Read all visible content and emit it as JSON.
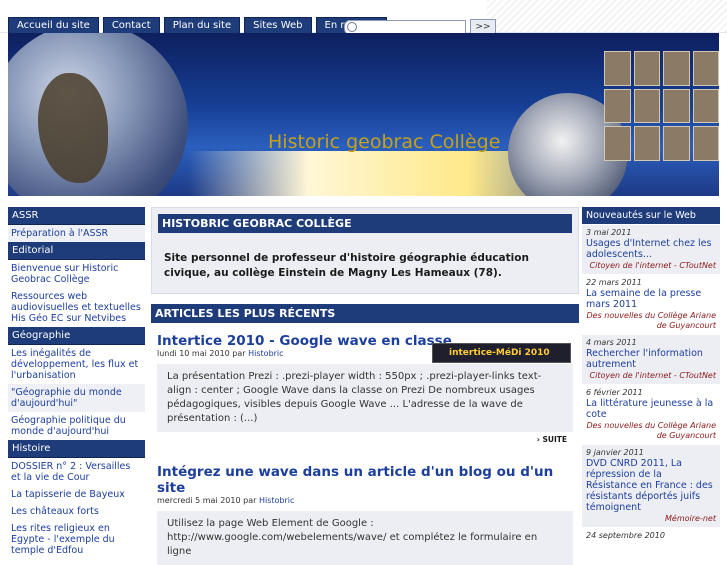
{
  "nav": {
    "tabs": [
      "Accueil du site",
      "Contact",
      "Plan du site",
      "Sites Web",
      "En résumé"
    ],
    "search_button": ">>"
  },
  "banner": {
    "title": "Historic geobrac Collège"
  },
  "left_sidebar": {
    "sections": [
      {
        "heading": "ASSR",
        "items": [
          "Préparation à l'ASSR"
        ]
      },
      {
        "heading": "Editorial",
        "items": [
          "Bienvenue sur Historic Geobrac Collège",
          "Ressources web audiovisuelles et textuelles His Géo EC sur Netvibes"
        ]
      },
      {
        "heading": "Géographie",
        "items": [
          "Les inégalités de développement, les flux et l'urbanisation",
          "\"Géographie du monde d'aujourd'hui\"",
          "Géographie politique du monde d'aujourd'hui"
        ]
      },
      {
        "heading": "Histoire",
        "items": [
          "DOSSIER n° 2 : Versailles et la vie de Cour",
          "La tapisserie de Bayeux",
          "Les châteaux forts",
          "Les rites religieux en Egypte - l'exemple du temple d'Edfou"
        ]
      }
    ]
  },
  "main": {
    "site_heading": "HISTOBRIC GEOBRAC COLLÈGE",
    "intro": "Site personnel de professeur d'histoire géographie éducation civique, au collège Einstein de Magny Les Hameaux (78).",
    "recent_heading": "ARTICLES LES PLUS RÉCENTS",
    "articles": [
      {
        "title": "Intertice 2010 - Google wave en classe",
        "date": "lundi 10 mai 2010",
        "by": "par",
        "author": "Histobric",
        "thumb_label": "intertice-MéDi 2010",
        "excerpt": "La présentation Prezi : .prezi-player width : 550px ; .prezi-player-links text-align : center ; Google Wave dans la classe on Prezi De nombreux usages pédagogiques, visibles depuis Google Wave ... L'adresse de la wave de présentation : (...)",
        "more": "› SUITE"
      },
      {
        "title": "Intégrez une wave dans un article d'un blog ou d'un site",
        "date": "mercredi 5 mai 2010",
        "by": "par",
        "author": "Histobric",
        "excerpt": "Utilisez la page Web Element de Google : http://www.google.com/webelements/wave/ et complétez le formulaire en ligne"
      }
    ]
  },
  "right_sidebar": {
    "heading": "Nouveautés sur le Web",
    "items": [
      {
        "date": "3 mai 2011",
        "title": "Usages d'Internet chez les adolescents...",
        "source": "Citoyen de l'internet - CToutNet"
      },
      {
        "date": "22 mars 2011",
        "title": "La semaine de la presse mars 2011",
        "source": "Des nouvelles du Collège Ariane de Guyancourt"
      },
      {
        "date": "4 mars 2011",
        "title": "Rechercher l'information autrement",
        "source": "Citoyen de l'internet - CToutNet"
      },
      {
        "date": "6 février 2011",
        "title": "La littérature jeunesse à la cote",
        "source": "Des nouvelles du Collège Ariane de Guyancourt"
      },
      {
        "date": "9 janvier 2011",
        "title": "DVD CNRD 2011, La répression de la Résistance en France : des résistants déportés juifs témoignent",
        "source": "Mémoire-net"
      },
      {
        "date": "24 septembre 2010",
        "title": "",
        "source": ""
      }
    ]
  }
}
